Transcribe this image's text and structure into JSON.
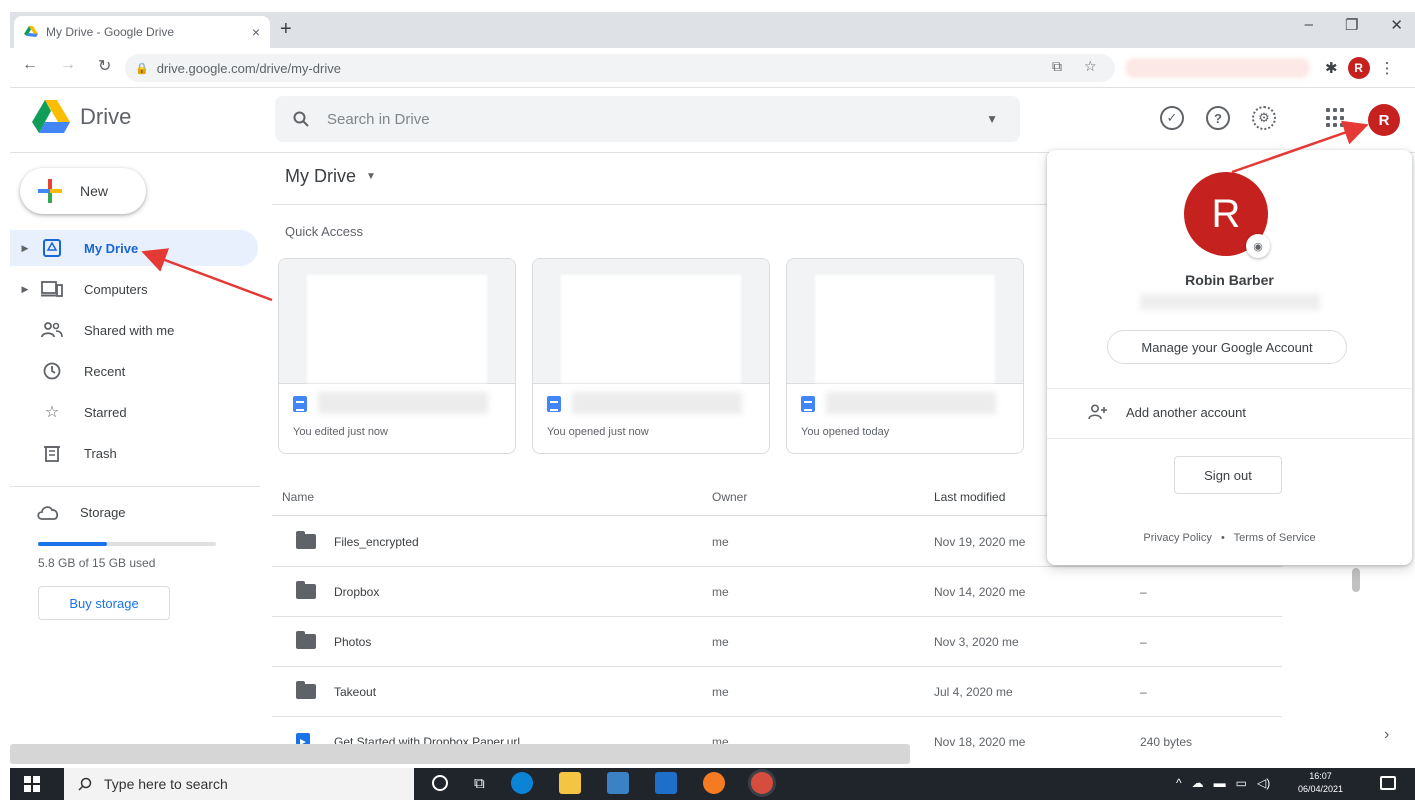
{
  "browser": {
    "tab_title": "My Drive - Google Drive",
    "tab_close": "×",
    "new_tab": "+",
    "url": "drive.google.com/drive/my-drive",
    "profile_initial": "R",
    "window_controls": [
      "–",
      "❐",
      "✕"
    ]
  },
  "drive": {
    "logo_text": "Drive",
    "search_placeholder": "Search in Drive",
    "avatar_initial": "R"
  },
  "sidebar": {
    "new_label": "New",
    "items": [
      {
        "label": "My Drive"
      },
      {
        "label": "Computers"
      },
      {
        "label": "Shared with me"
      },
      {
        "label": "Recent"
      },
      {
        "label": "Starred"
      },
      {
        "label": "Trash"
      }
    ],
    "storage_label": "Storage",
    "storage_used_text": "5.8 GB of 15 GB used",
    "storage_used_fraction": 0.39,
    "buy_storage": "Buy storage"
  },
  "main": {
    "title": "My Drive",
    "quick_access_label": "Quick Access",
    "quick_access": [
      {
        "subtitle": "You edited just now"
      },
      {
        "subtitle": "You opened just now"
      },
      {
        "subtitle": "You opened today"
      }
    ],
    "columns": {
      "name": "Name",
      "owner": "Owner",
      "modified": "Last modified"
    },
    "files": [
      {
        "name": "Files_encrypted",
        "owner": "me",
        "modified": "Nov 19, 2020 me",
        "size": "",
        "kind": "folder"
      },
      {
        "name": "Dropbox",
        "owner": "me",
        "modified": "Nov 14, 2020 me",
        "size": "–",
        "kind": "folder"
      },
      {
        "name": "Photos",
        "owner": "me",
        "modified": "Nov 3, 2020 me",
        "size": "–",
        "kind": "folder"
      },
      {
        "name": "Takeout",
        "owner": "me",
        "modified": "Jul 4, 2020 me",
        "size": "–",
        "kind": "folder"
      },
      {
        "name": "Get Started with Dropbox Paper.url",
        "owner": "me",
        "modified": "Nov 18, 2020 me",
        "size": "240 bytes",
        "kind": "file"
      }
    ]
  },
  "account_popup": {
    "avatar_initial": "R",
    "name": "Robin Barber",
    "manage_button": "Manage your Google Account",
    "add_account": "Add another account",
    "sign_out": "Sign out",
    "privacy": "Privacy Policy",
    "separator": "•",
    "terms": "Terms of Service"
  },
  "taskbar": {
    "search_placeholder": "Type here to search",
    "time": "16:07",
    "date": "06/04/2021"
  },
  "colors": {
    "accent_blue": "#1a73e8",
    "avatar_red": "#c5221f",
    "annotation_red": "#e53935"
  }
}
